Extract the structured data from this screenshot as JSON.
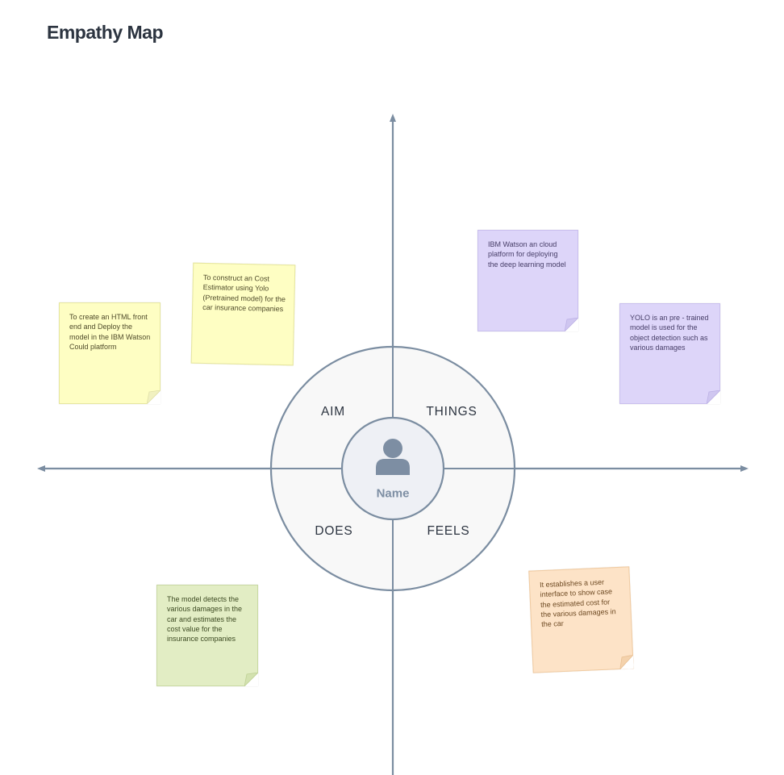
{
  "title": "Empathy Map",
  "center": {
    "name": "Name",
    "icon": "user-avatar-icon"
  },
  "quadrants": {
    "aim": "AIM",
    "things": "THINGS",
    "does": "DOES",
    "feels": "FEELS"
  },
  "colors": {
    "axis": "#7b8da1",
    "circle_fill": "#f8f8f8",
    "inner_fill": "#eef0f5",
    "note_yellow": "#fefec3",
    "note_purple": "#ddd5f9",
    "note_green": "#e2edc4",
    "note_orange": "#fde3c7"
  },
  "notes": [
    {
      "id": "aim-note-1",
      "quadrant": "AIM",
      "color": "yellow",
      "text": "To create an HTML front end and Deploy the model in the IBM Watson Could platform"
    },
    {
      "id": "aim-note-2",
      "quadrant": "AIM",
      "color": "yellow",
      "text": "To construct an Cost Estimator using Yolo (Pretrained model) for the car insurance companies"
    },
    {
      "id": "things-note-1",
      "quadrant": "THINGS",
      "color": "purple",
      "text": "IBM Watson an cloud platform for deploying the deep learning model"
    },
    {
      "id": "things-note-2",
      "quadrant": "THINGS",
      "color": "purple",
      "text": "YOLO is an pre - trained model is used for the object detection such as various damages"
    },
    {
      "id": "does-note-1",
      "quadrant": "DOES",
      "color": "green",
      "text": "The model detects the various damages in the car and estimates the cost value for the insurance companies"
    },
    {
      "id": "feels-note-1",
      "quadrant": "FEELS",
      "color": "orange",
      "text": "It establishes a user interface to show case the estimated cost for the various damages in the car"
    }
  ]
}
